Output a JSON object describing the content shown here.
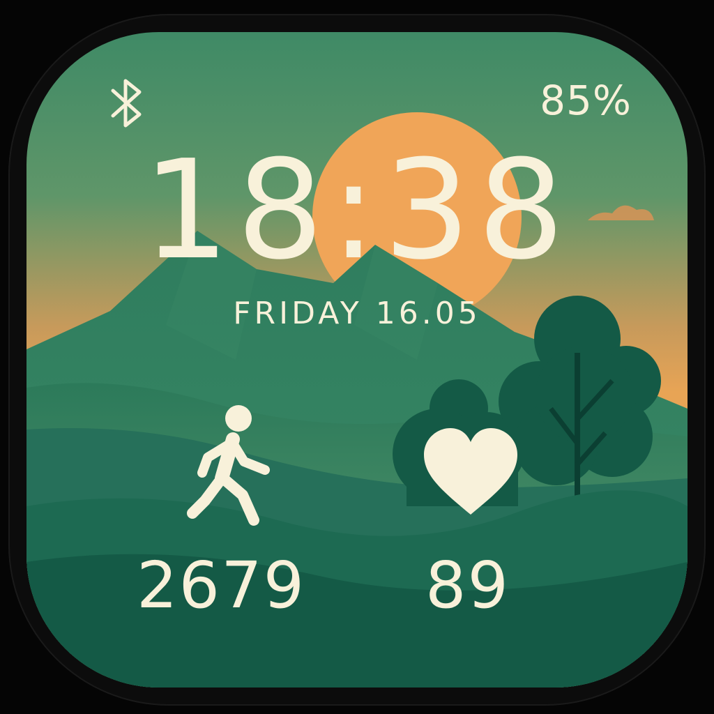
{
  "watch_face": {
    "battery": "85%",
    "time": "18:38",
    "date": "FRIDAY  16.05",
    "steps": "2679",
    "heart_rate": "89"
  },
  "icons": {
    "connectivity": "bluetooth-icon",
    "steps": "walking-person-icon",
    "heart_rate": "heart-icon"
  },
  "colors": {
    "text": "#f8f1da",
    "sun": "#f0a558",
    "sky_top": "#3f8a66",
    "sky_bottom": "#e8a455",
    "mountain": "#2f7a5c",
    "hills_dark": "#145a46"
  }
}
